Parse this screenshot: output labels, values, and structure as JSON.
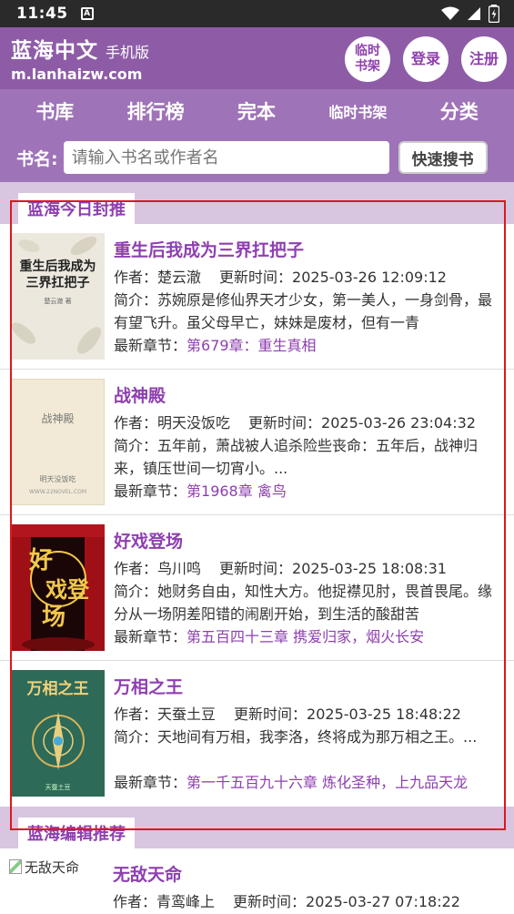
{
  "status_bar": {
    "time": "11:45",
    "notif_glyph": "A"
  },
  "header": {
    "site_name": "蓝海中文",
    "site_sub": "手机版",
    "domain": "m.lanhaizw.com",
    "buttons": [
      "临时\n书架",
      "登录",
      "注册"
    ]
  },
  "nav": {
    "items": [
      "书库",
      "排行榜",
      "完本",
      "临时书架",
      "分类"
    ]
  },
  "search": {
    "label": "书名:",
    "placeholder": "请输入书名或作者名",
    "button": "快速搜书"
  },
  "section1": {
    "title": "蓝海今日封推",
    "books": [
      {
        "title": "重生后我成为三界扛把子",
        "author_label": "作者：",
        "author": "楚云澈",
        "update_label": "更新时间：",
        "update": "2025-03-26 12:09:12",
        "intro_label": "简介：",
        "intro": "苏婉原是修仙界天才少女，第一美人，一身剑骨，最有望飞升。虽父母早亡，妹妹是废材，但有一青",
        "latest_label": "最新章节：",
        "latest": "第679章：重生真相",
        "cover_title": "重生后我成为三界扛把子",
        "cover_author": "楚云澈 著"
      },
      {
        "title": "战神殿",
        "author_label": "作者：",
        "author": "明天没饭吃",
        "update_label": "更新时间：",
        "update": "2025-03-26 23:04:32",
        "intro_label": "简介：",
        "intro": "五年前，萧战被人追杀险些丧命：五年后，战神归来，镇压世间一切宵小。...",
        "latest_label": "最新章节：",
        "latest": "第1968章 禽鸟",
        "cover_title": "战神殿",
        "cover_author": "明天没饭吃",
        "cover_url": "WWW.22NOVEL.COM"
      },
      {
        "title": "好戏登场",
        "author_label": "作者：",
        "author": "鸟川鸣",
        "update_label": "更新时间：",
        "update": "2025-03-25 18:08:31",
        "intro_label": "简介：",
        "intro": "她财务自由，知性大方。他捉襟见肘，畏首畏尾。缘分从一场阴差阳错的闹剧开始，到生活的酸甜苦",
        "latest_label": "最新章节：",
        "latest": "第五百四十三章 携爱归家，烟火长安",
        "cover_title": "好戏登场"
      },
      {
        "title": "万相之王",
        "author_label": "作者：",
        "author": "天蚕土豆",
        "update_label": "更新时间：",
        "update": "2025-03-25 18:48:22",
        "intro_label": "简介：",
        "intro": "天地间有万相，我李洛，终将成为那万相之王。...",
        "latest_label": "最新章节：",
        "latest": "第一千五百九十六章 炼化圣种，上九品天龙",
        "cover_title": "万相之王",
        "cover_author": "天蚕土豆"
      }
    ]
  },
  "section2": {
    "title": "蓝海编辑推荐",
    "books": [
      {
        "img_alt": "无敌天命",
        "title": "无敌天命",
        "author_label": "作者：",
        "author": "青鸾峰上",
        "update_label": "更新时间：",
        "update": "2025-03-27 07:18:22"
      }
    ]
  },
  "colors": {
    "header_bg": "#8e5ca7",
    "nav_bg": "#9f73b8",
    "accent": "#8e3fb0",
    "section_bg": "#d8c5e0",
    "highlight_box": "#e0151f"
  }
}
